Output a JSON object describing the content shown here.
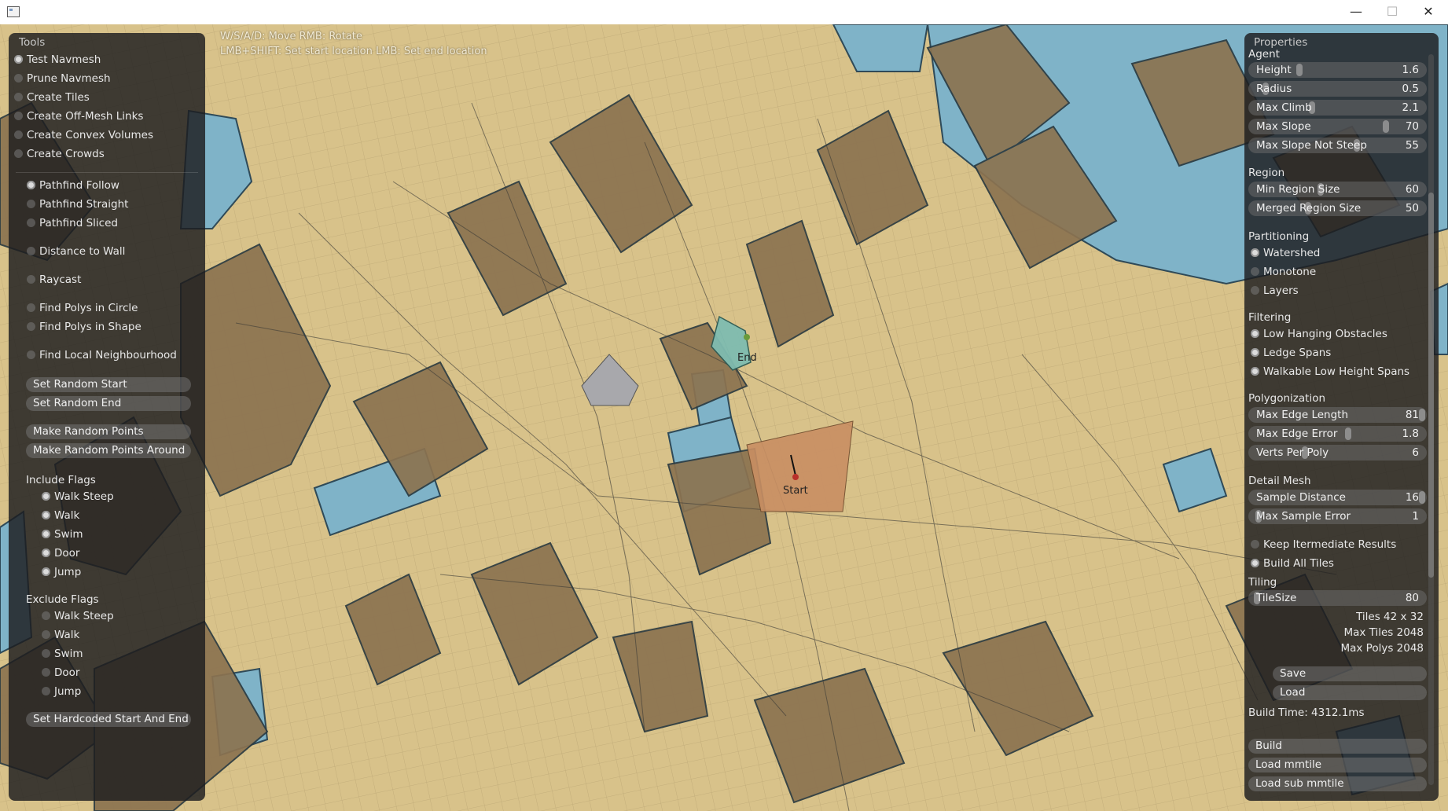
{
  "window": {
    "minimize_glyph": "—",
    "maximize_glyph": "☐",
    "close_glyph": "✕"
  },
  "viewport": {
    "hint_line1": "W/S/A/D: Move  RMB: Rotate",
    "hint_line2": "LMB+SHIFT: Set start location  LMB: Set end location",
    "end_label": "End",
    "start_label": "Start"
  },
  "colors": {
    "terrain": "#d8c28a",
    "water": "#7fb3c8",
    "wall": "#8c7350",
    "start_area": "#c98f63",
    "end_area": "#7fbcb0",
    "panel": "#1c1c1e"
  },
  "tools": {
    "title": "Tools",
    "modes": [
      {
        "label": "Test Navmesh",
        "checked": true
      },
      {
        "label": "Prune Navmesh",
        "checked": false
      },
      {
        "label": "Create Tiles",
        "checked": false
      },
      {
        "label": "Create Off-Mesh Links",
        "checked": false
      },
      {
        "label": "Create Convex Volumes",
        "checked": false
      },
      {
        "label": "Create Crowds",
        "checked": false
      }
    ],
    "path_modes": [
      {
        "label": "Pathfind Follow",
        "checked": true
      },
      {
        "label": "Pathfind Straight",
        "checked": false
      },
      {
        "label": "Pathfind Sliced",
        "checked": false
      },
      {
        "label": "Distance to Wall",
        "checked": false
      },
      {
        "label": "Raycast",
        "checked": false
      },
      {
        "label": "Find Polys in Circle",
        "checked": false
      },
      {
        "label": "Find Polys in Shape",
        "checked": false
      },
      {
        "label": "Find Local Neighbourhood",
        "checked": false
      }
    ],
    "buttons": {
      "set_random_start": "Set Random Start",
      "set_random_end": "Set Random End",
      "make_random_points": "Make Random Points",
      "make_random_points_around": "Make Random Points Around",
      "set_hardcoded": "Set Hardcoded Start And End"
    },
    "include_flags_title": "Include Flags",
    "include_flags": [
      {
        "label": "Walk Steep",
        "checked": true
      },
      {
        "label": "Walk",
        "checked": true
      },
      {
        "label": "Swim",
        "checked": true
      },
      {
        "label": "Door",
        "checked": true
      },
      {
        "label": "Jump",
        "checked": true
      }
    ],
    "exclude_flags_title": "Exclude Flags",
    "exclude_flags": [
      {
        "label": "Walk Steep",
        "checked": false
      },
      {
        "label": "Walk",
        "checked": false
      },
      {
        "label": "Swim",
        "checked": false
      },
      {
        "label": "Door",
        "checked": false
      },
      {
        "label": "Jump",
        "checked": false
      }
    ]
  },
  "properties": {
    "title": "Properties",
    "agent_title": "Agent",
    "agent": [
      {
        "label": "Height",
        "value": "1.6",
        "level": 0.28
      },
      {
        "label": "Radius",
        "value": "0.5",
        "level": 0.08
      },
      {
        "label": "Max Climb",
        "value": "2.1",
        "level": 0.35
      },
      {
        "label": "Max Slope",
        "value": "70",
        "level": 0.78
      },
      {
        "label": "Max Slope Not Steep",
        "value": "55",
        "level": 0.61
      }
    ],
    "region_title": "Region",
    "region": [
      {
        "label": "Min Region Size",
        "value": "60",
        "level": 0.4
      },
      {
        "label": "Merged Region Size",
        "value": "50",
        "level": 0.33
      }
    ],
    "partitioning_title": "Partitioning",
    "partitioning": [
      {
        "label": "Watershed",
        "checked": true
      },
      {
        "label": "Monotone",
        "checked": false
      },
      {
        "label": "Layers",
        "checked": false
      }
    ],
    "filtering_title": "Filtering",
    "filtering": [
      {
        "label": "Low Hanging Obstacles",
        "checked": true
      },
      {
        "label": "Ledge Spans",
        "checked": true
      },
      {
        "label": "Walkable Low Height Spans",
        "checked": true
      }
    ],
    "polygonization_title": "Polygonization",
    "polygonization": [
      {
        "label": "Max Edge Length",
        "value": "81",
        "level": 0.99
      },
      {
        "label": "Max Edge Error",
        "value": "1.8",
        "level": 0.56
      },
      {
        "label": "Verts Per Poly",
        "value": "6",
        "level": 0.31
      }
    ],
    "detail_title": "Detail Mesh",
    "detail": [
      {
        "label": "Sample Distance",
        "value": "16",
        "level": 0.99
      },
      {
        "label": "Max Sample Error",
        "value": "1",
        "level": 0.04
      }
    ],
    "keep_intermediate": {
      "label": "Keep Itermediate Results",
      "checked": false
    },
    "build_all_tiles": {
      "label": "Build All Tiles",
      "checked": true
    },
    "tiling_title": "Tiling",
    "tilesize": {
      "label": "TileSize",
      "value": "80",
      "level": 0.03
    },
    "tiles_info": "Tiles  42 x 32",
    "max_tiles_info": "Max Tiles  2048",
    "max_polys_info": "Max Polys  2048",
    "save": "Save",
    "load": "Load",
    "build_time": "Build Time: 4312.1ms",
    "build": "Build",
    "load_mmtile": "Load mmtile",
    "load_sub_mmtile": "Load sub mmtile"
  }
}
